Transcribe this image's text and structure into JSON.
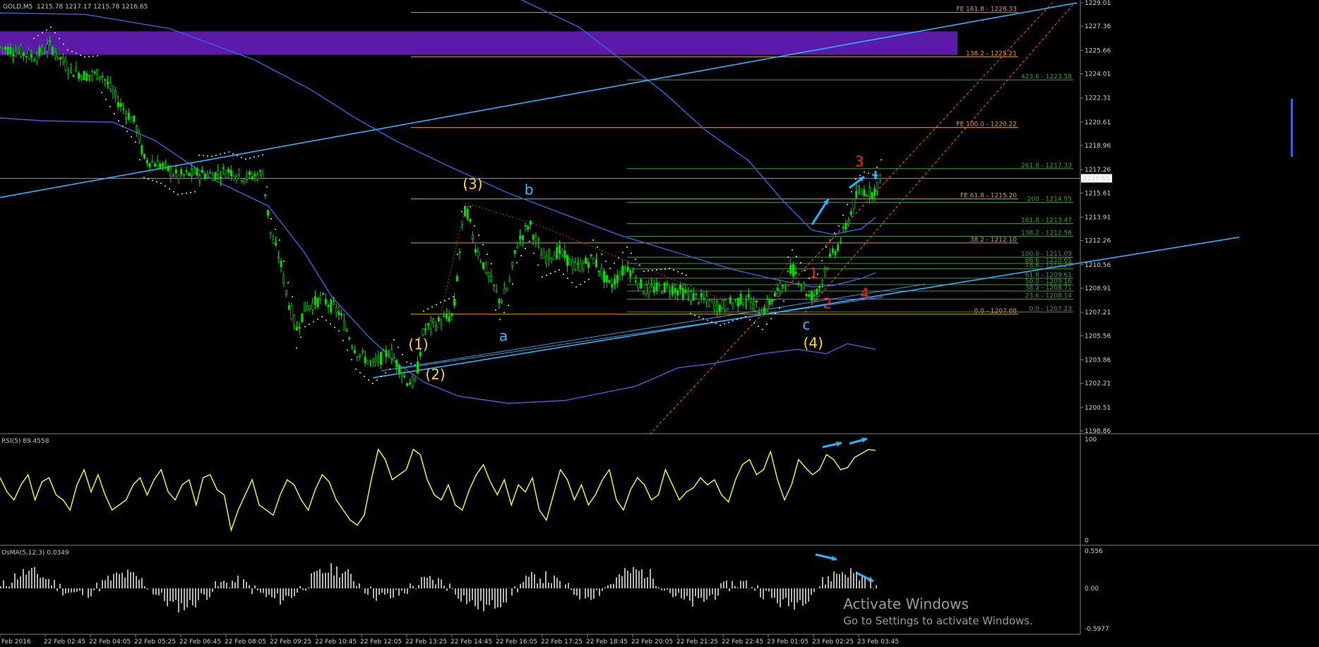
{
  "header": {
    "symbol": "GOLD,M5",
    "ohlc": "1215.78 1217.17 1215.78 1216.65"
  },
  "colors": {
    "background": "#000000",
    "candle": "#00e000",
    "ma": "#3f5fe0",
    "trendline": "#25b3ff",
    "fib_orange": "#d9a22a",
    "fib_green": "#3e9a3e",
    "supply_zone": "#5b1aa8",
    "rsi": "#ffff00",
    "osma": "#b0b0b0",
    "wave_label_yellow": "#ffd21a",
    "wave_label_cyan": "#35b9ff",
    "wave_label_red": "#ff2020",
    "channel": "#ff5a1a"
  },
  "chart_data": [
    {
      "type": "candlestick",
      "title": "GOLD,M5",
      "price_axis_ticks": [
        "1229.01",
        "1227.36",
        "1225.66",
        "1224.01",
        "1222.31",
        "1220.61",
        "1218.96",
        "1217.26",
        "1215.61",
        "1213.91",
        "1212.26",
        "1210.56",
        "1208.91",
        "1207.21",
        "1205.56",
        "1203.86",
        "1202.21",
        "1200.51",
        "1198.86"
      ],
      "ylim": [
        1198.86,
        1229.01
      ],
      "current_price": "1216.65",
      "time_axis_ticks": [
        "Feb 2016",
        "22 Feb 02:45",
        "22 Feb 04:05",
        "22 Feb 05:25",
        "22 Feb 06:45",
        "22 Feb 08:05",
        "22 Feb 09:25",
        "22 Feb 10:45",
        "22 Feb 12:05",
        "22 Feb 13:25",
        "22 Feb 14:45",
        "22 Feb 16:05",
        "22 Feb 17:25",
        "22 Feb 18:45",
        "22 Feb 20:05",
        "22 Feb 21:25",
        "22 Feb 22:45",
        "23 Feb 01:05",
        "23 Feb 02:25",
        "23 Feb 03:45"
      ],
      "price_path": [
        [
          0,
          1225.9
        ],
        [
          20,
          1225.6
        ],
        [
          40,
          1225.2
        ],
        [
          60,
          1226.0
        ],
        [
          80,
          1224.4
        ],
        [
          100,
          1223.9
        ],
        [
          120,
          1224.0
        ],
        [
          140,
          1222.0
        ],
        [
          160,
          1220.5
        ],
        [
          170,
          1218.0
        ],
        [
          190,
          1217.6
        ],
        [
          210,
          1216.8
        ],
        [
          230,
          1217.0
        ],
        [
          250,
          1216.9
        ],
        [
          270,
          1217.2
        ],
        [
          290,
          1216.7
        ],
        [
          310,
          1217.0
        ],
        [
          320,
          1212.5
        ],
        [
          330,
          1211.0
        ],
        [
          340,
          1208.0
        ],
        [
          350,
          1206.0
        ],
        [
          360,
          1207.5
        ],
        [
          380,
          1208.2
        ],
        [
          400,
          1207.2
        ],
        [
          420,
          1204.5
        ],
        [
          440,
          1203.5
        ],
        [
          460,
          1204.5
        ],
        [
          480,
          1202.4
        ],
        [
          490,
          1202.2
        ],
        [
          500,
          1206.0
        ],
        [
          520,
          1206.6
        ],
        [
          535,
          1207.0
        ],
        [
          545,
          1213.0
        ],
        [
          550,
          1214.7
        ],
        [
          560,
          1212.0
        ],
        [
          575,
          1210.0
        ],
        [
          590,
          1208.0
        ],
        [
          600,
          1209.0
        ],
        [
          610,
          1212.0
        ],
        [
          625,
          1213.5
        ],
        [
          640,
          1211.0
        ],
        [
          660,
          1211.5
        ],
        [
          680,
          1210.3
        ],
        [
          700,
          1211.0
        ],
        [
          720,
          1209.0
        ],
        [
          740,
          1210.5
        ],
        [
          760,
          1208.8
        ],
        [
          790,
          1209.0
        ],
        [
          820,
          1208.3
        ],
        [
          850,
          1207.6
        ],
        [
          880,
          1208.2
        ],
        [
          900,
          1207.3
        ],
        [
          920,
          1208.8
        ],
        [
          935,
          1210.3
        ],
        [
          945,
          1209.4
        ],
        [
          955,
          1208.3
        ],
        [
          965,
          1208.6
        ],
        [
          975,
          1210.5
        ],
        [
          990,
          1212.0
        ],
        [
          1000,
          1213.5
        ],
        [
          1010,
          1215.3
        ],
        [
          1020,
          1215.8
        ],
        [
          1030,
          1215.6
        ],
        [
          1040,
          1216.65
        ]
      ],
      "fib_retracements_orange": [
        {
          "label": "FE 161.8 - 1228.33",
          "price": 1228.33
        },
        {
          "label": "138.2 - 1225.21",
          "price": 1225.21
        },
        {
          "label": "FE 100.0 - 1220.22",
          "price": 1220.22
        },
        {
          "label": "FE 61.8 - 1215.20",
          "price": 1215.2
        },
        {
          "label": "38.2 - 1212.10",
          "price": 1212.1
        },
        {
          "label": "0.0 - 1207.08",
          "price": 1207.08
        }
      ],
      "fib_retracements_green": [
        {
          "label": "423.6 - 1223.58",
          "price": 1223.58
        },
        {
          "label": "261.8 - 1217.33",
          "price": 1217.33
        },
        {
          "label": "200 - 1214.95",
          "price": 1214.95
        },
        {
          "label": "161.8 - 1213.47",
          "price": 1213.47
        },
        {
          "label": "138.2 - 1212.56",
          "price": 1212.56
        },
        {
          "label": "100.0 - 1211.09",
          "price": 1211.09
        },
        {
          "label": "88.6 - 1210.65",
          "price": 1210.65
        },
        {
          "label": "78.6 - 1210.27",
          "price": 1210.27
        },
        {
          "label": "61.8 - 1209.61",
          "price": 1209.61
        },
        {
          "label": "50.0 - 1209.16",
          "price": 1209.16
        },
        {
          "label": "38.2 - 1208.71",
          "price": 1208.71
        },
        {
          "label": "23.6 - 1208.14",
          "price": 1208.14
        },
        {
          "label": "0.0 - 1207.23",
          "price": 1207.23
        }
      ],
      "wave_labels": [
        {
          "text": "(1)",
          "color": "yellow",
          "bar": 487,
          "price": 1204.6
        },
        {
          "text": "(2)",
          "color": "yellow",
          "bar": 507,
          "price": 1202.5
        },
        {
          "text": "(3)",
          "color": "yellow",
          "bar": 551,
          "price": 1215.9
        },
        {
          "text": "(4)",
          "color": "yellow",
          "bar": 953,
          "price": 1204.7
        },
        {
          "text": "a",
          "color": "cyan",
          "bar": 594,
          "price": 1205.2
        },
        {
          "text": "b",
          "color": "cyan",
          "bar": 624,
          "price": 1215.5
        },
        {
          "text": "c",
          "color": "cyan",
          "bar": 952,
          "price": 1206.0
        },
        {
          "text": "1",
          "color": "red",
          "bar": 960,
          "price": 1209.6
        },
        {
          "text": "2",
          "color": "red",
          "bar": 976,
          "price": 1207.5
        },
        {
          "text": "3",
          "color": "red",
          "bar": 1014,
          "price": 1217.5
        },
        {
          "text": "4",
          "color": "red",
          "bar": 1020,
          "price": 1208.2
        }
      ]
    },
    {
      "type": "line",
      "title": "RSI(5) 89.4558",
      "ylim": [
        0,
        100
      ],
      "ticks": [
        "100",
        "0"
      ],
      "series": [
        {
          "name": "RSI(5)",
          "values": [
            62,
            48,
            40,
            55,
            65,
            40,
            58,
            62,
            45,
            40,
            30,
            55,
            70,
            48,
            65,
            45,
            30,
            35,
            40,
            55,
            62,
            45,
            60,
            70,
            48,
            40,
            55,
            60,
            35,
            62,
            65,
            50,
            45,
            10,
            30,
            45,
            60,
            35,
            30,
            25,
            45,
            60,
            55,
            40,
            30,
            50,
            65,
            58,
            40,
            30,
            20,
            15,
            25,
            60,
            90,
            80,
            60,
            65,
            70,
            90,
            85,
            60,
            45,
            40,
            55,
            35,
            30,
            50,
            65,
            75,
            58,
            45,
            60,
            35,
            55,
            48,
            62,
            30,
            20,
            45,
            70,
            60,
            40,
            55,
            35,
            45,
            60,
            70,
            40,
            30,
            50,
            62,
            55,
            40,
            45,
            70,
            55,
            40,
            48,
            52,
            62,
            55,
            60,
            45,
            38,
            60,
            75,
            80,
            65,
            70,
            88,
            60,
            40,
            55,
            80,
            72,
            65,
            70,
            85,
            80,
            70,
            72,
            82,
            86,
            90,
            89
          ]
        }
      ]
    },
    {
      "type": "bar",
      "title": "OsMA(5,12,3) 0.0349",
      "ylim": [
        -0.5977,
        0.556
      ],
      "ticks": [
        "0.556",
        "0.00",
        "-0.5977"
      ]
    }
  ],
  "watermark": {
    "line1": "Activate Windows",
    "line2": "Go to Settings to activate Windows."
  }
}
